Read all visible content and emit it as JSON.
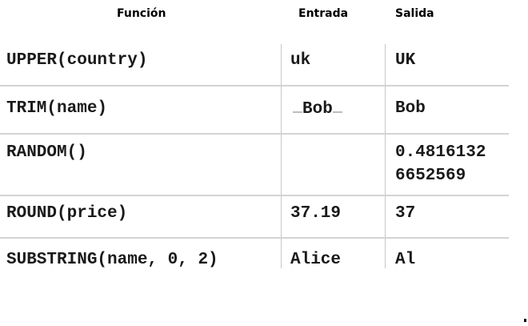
{
  "table": {
    "headers": {
      "function": "Función",
      "input": "Entrada",
      "output": "Salida"
    },
    "rows": [
      {
        "function": "UPPER(country)",
        "input": "uk",
        "output": "UK"
      },
      {
        "function": "TRIM(name)",
        "input": "Bob",
        "output": "Bob"
      },
      {
        "function": "RANDOM()",
        "input": "",
        "output": "0.4816132",
        "output_line2": "6652569"
      },
      {
        "function": "ROUND(price)",
        "input": "37.19",
        "output": "37"
      },
      {
        "function": "SUBSTRING(name, 0, 2)",
        "input": "Alice",
        "output": "Al"
      }
    ]
  }
}
